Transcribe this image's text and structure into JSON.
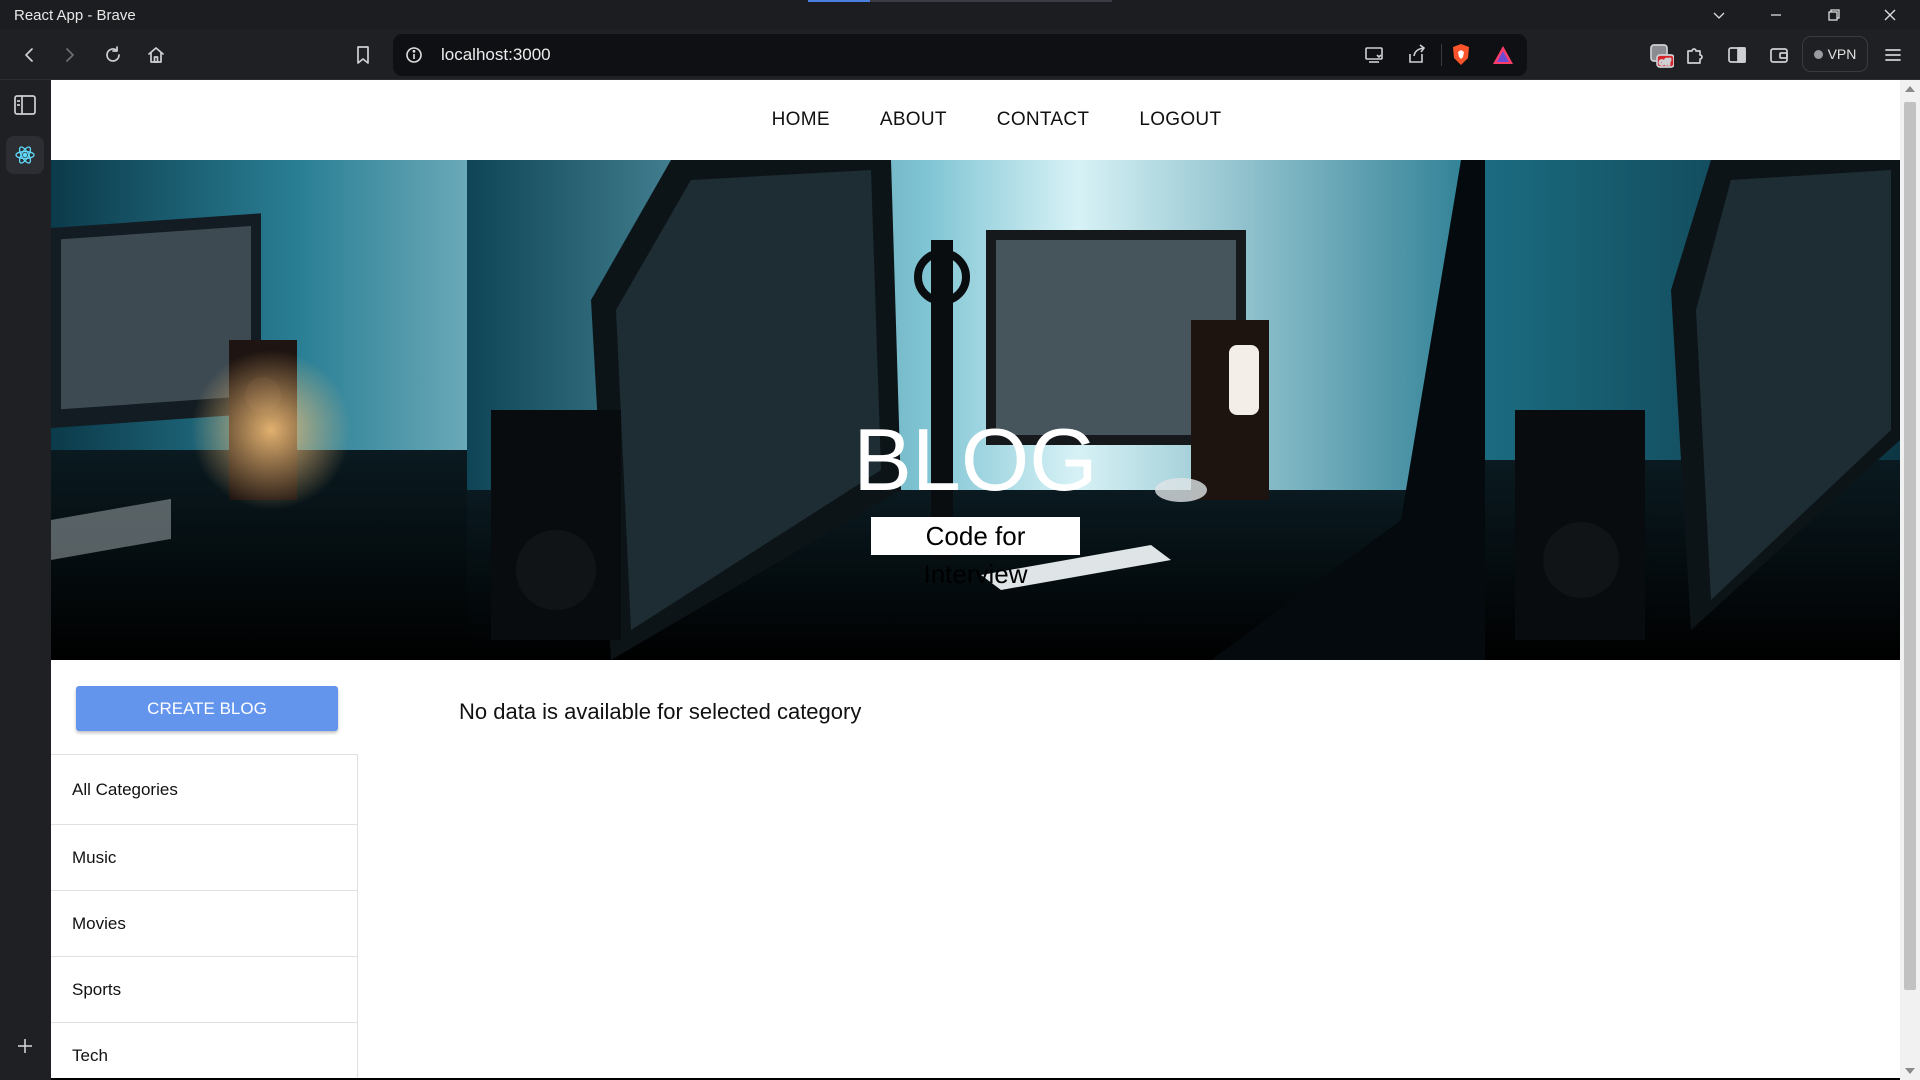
{
  "window": {
    "title": "React App - Brave"
  },
  "address_bar": {
    "url": "localhost:3000"
  },
  "toolbar": {
    "vpn_label": "VPN",
    "shields_badge": "off"
  },
  "nav": {
    "items": [
      "HOME",
      "ABOUT",
      "CONTACT",
      "LOGOUT"
    ]
  },
  "hero": {
    "title": "BLOG",
    "subtitle": "Code for Interview"
  },
  "sidebar": {
    "create_button": "CREATE BLOG",
    "categories": [
      "All Categories",
      "Music",
      "Movies",
      "Sports",
      "Tech"
    ]
  },
  "main": {
    "empty_message": "No data is available for selected category"
  },
  "colors": {
    "accent": "#6495ed",
    "chrome": "#1f2024"
  }
}
